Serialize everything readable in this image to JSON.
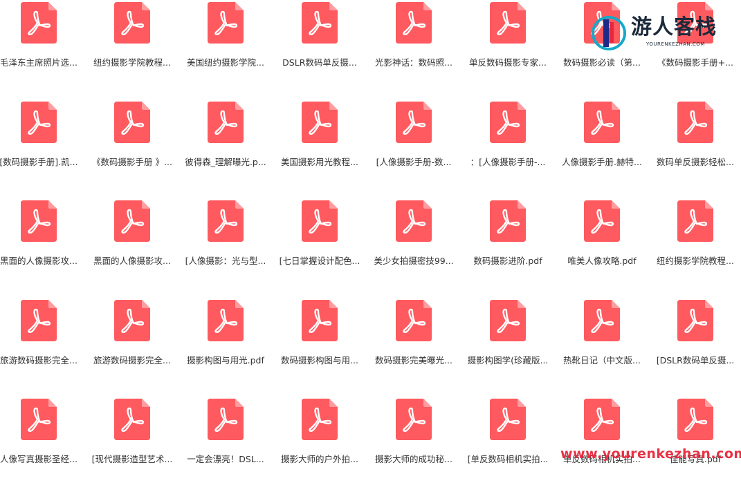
{
  "colors": {
    "pdf_icon": "#ff5a5f",
    "pdf_fold": "#ff9c9f",
    "label_text": "#333333",
    "watermark": "#e8263c"
  },
  "file_icon_name": "pdf-file-icon",
  "files": [
    {
      "name": "毛泽东主席照片选..."
    },
    {
      "name": "纽约摄影学院教程..."
    },
    {
      "name": "美国纽约摄影学院..."
    },
    {
      "name": "DSLR数码单反摄..."
    },
    {
      "name": "光影神话：数码照..."
    },
    {
      "name": "单反数码摄影专家..."
    },
    {
      "name": "数码摄影必读（第..."
    },
    {
      "name": "《数码摄影手册+..."
    },
    {
      "name": "[数码摄影手册].凯..."
    },
    {
      "name": "《数码摄影手册 》..."
    },
    {
      "name": "彼得森_理解曝光.p..."
    },
    {
      "name": "美国摄影用光教程..."
    },
    {
      "name": "[人像摄影手册-数..."
    },
    {
      "name": "：[人像摄影手册-..."
    },
    {
      "name": "人像摄影手册.赫特..."
    },
    {
      "name": "数码单反摄影轻松..."
    },
    {
      "name": "黑面的人像摄影攻..."
    },
    {
      "name": "黑面的人像摄影攻..."
    },
    {
      "name": "[人像摄影：光与型..."
    },
    {
      "name": "[七日掌握设计配色..."
    },
    {
      "name": "美少女拍摄密技99..."
    },
    {
      "name": "数码摄影进阶.pdf"
    },
    {
      "name": "唯美人像攻略.pdf"
    },
    {
      "name": "纽约摄影学院教程..."
    },
    {
      "name": "旅游数码摄影完全..."
    },
    {
      "name": "旅游数码摄影完全..."
    },
    {
      "name": "摄影构图与用光.pdf"
    },
    {
      "name": "数码摄影构图与用..."
    },
    {
      "name": "数码摄影完美曝光..."
    },
    {
      "name": "摄影构图学(珍藏版..."
    },
    {
      "name": "热靴日记（中文版..."
    },
    {
      "name": "[DSLR数码单反摄..."
    },
    {
      "name": "人像写真摄影圣经..."
    },
    {
      "name": "[现代摄影造型艺术..."
    },
    {
      "name": "一定会漂亮！DSL..."
    },
    {
      "name": "摄影大师的户外拍..."
    },
    {
      "name": "摄影大师的成功秘..."
    },
    {
      "name": "[单反数码相机实拍..."
    },
    {
      "name": "单反数码相机实拍..."
    },
    {
      "name": "佳能写真.pdf"
    }
  ],
  "logo": {
    "name_cn": "游人客栈",
    "name_en": "YOURENKEZHAN.COM"
  },
  "watermark": {
    "text": "www.yourenkezhan.com"
  }
}
